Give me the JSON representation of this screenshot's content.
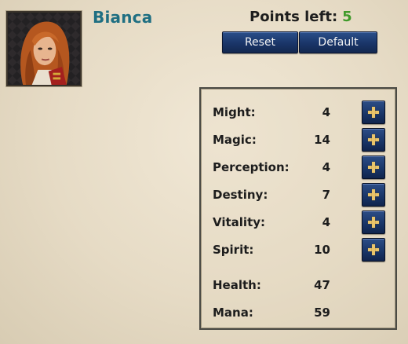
{
  "character": {
    "name": "Bianca"
  },
  "points": {
    "label": "Points left:",
    "value": "5"
  },
  "buttons": {
    "reset": "Reset",
    "default": "Default"
  },
  "attributes": [
    {
      "label": "Might:",
      "value": "4"
    },
    {
      "label": "Magic:",
      "value": "14"
    },
    {
      "label": "Perception:",
      "value": "4"
    },
    {
      "label": "Destiny:",
      "value": "7"
    },
    {
      "label": "Vitality:",
      "value": "4"
    },
    {
      "label": "Spirit:",
      "value": "10"
    }
  ],
  "derived": [
    {
      "label": "Health:",
      "value": "47"
    },
    {
      "label": "Mana:",
      "value": "59"
    }
  ],
  "colors": {
    "name": "#1f6f82",
    "points_value": "#3f9a2a",
    "button": "#1a3568",
    "plus": "#e9c46a"
  },
  "icons": {
    "portrait": "character-portrait",
    "increase": "plus-icon"
  }
}
